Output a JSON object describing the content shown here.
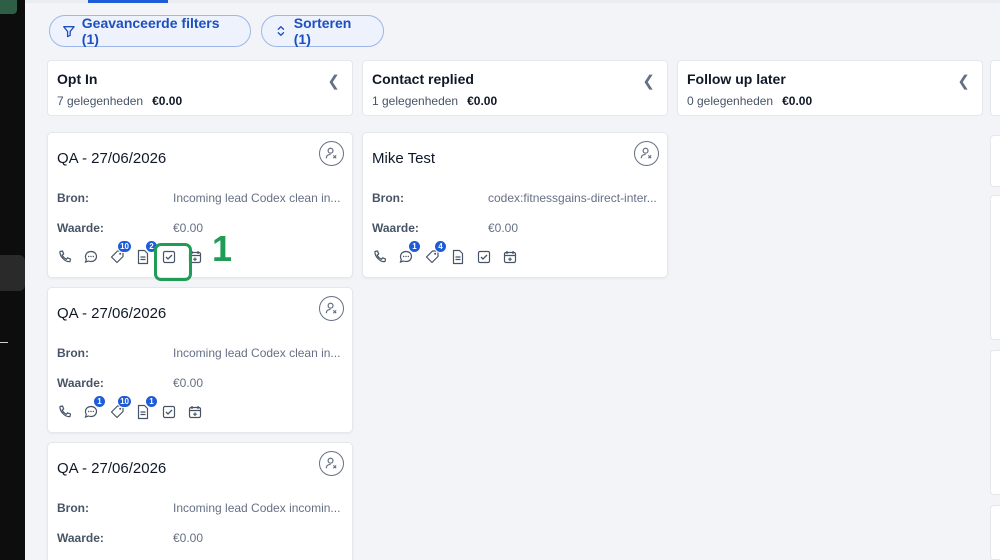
{
  "toolbar": {
    "filters_label": "Geavanceerde filters (1)",
    "sort_label": "Sorteren (1)"
  },
  "columns": [
    {
      "title": "Opt In",
      "count_label": "7 gelegenheden",
      "amount": "€0.00"
    },
    {
      "title": "Contact replied",
      "count_label": "1 gelegenheden",
      "amount": "€0.00"
    },
    {
      "title": "Follow up later",
      "count_label": "0 gelegenheden",
      "amount": "€0.00"
    }
  ],
  "cards": [
    {
      "title": "QA - 27/06/2026",
      "source_label": "Bron:",
      "source_value": "Incoming lead Codex clean in...",
      "value_label": "Waarde:",
      "value": "€0.00",
      "badges": {
        "messages": "",
        "tags": "10",
        "notes": "2"
      }
    },
    {
      "title": "QA - 27/06/2026",
      "source_label": "Bron:",
      "source_value": "Incoming lead Codex clean in...",
      "value_label": "Waarde:",
      "value": "€0.00",
      "badges": {
        "messages": "1",
        "tags": "10",
        "notes": "1"
      }
    },
    {
      "title": "QA - 27/06/2026",
      "source_label": "Bron:",
      "source_value": "Incoming lead Codex incomin...",
      "value_label": "Waarde:",
      "value": "€0.00",
      "badges": {
        "messages": "",
        "tags": "",
        "notes": ""
      }
    },
    {
      "title": "Mike Test",
      "source_label": "Bron:",
      "source_value": "codex:fitnessgains-direct-inter...",
      "value_label": "Waarde:",
      "value": "€0.00",
      "badges": {
        "messages": "1",
        "tags": "4",
        "notes": ""
      }
    }
  ],
  "annotation": {
    "number": "1",
    "color": "#1f9d55"
  },
  "colors": {
    "accent": "#1d5bd8",
    "background": "#f2f4f7"
  },
  "icons": [
    "filter-icon",
    "sort-icon",
    "chevron-left-icon",
    "unassigned-user-icon",
    "phone-icon",
    "message-icon",
    "tag-icon",
    "note-icon",
    "task-icon",
    "calendar-icon"
  ]
}
